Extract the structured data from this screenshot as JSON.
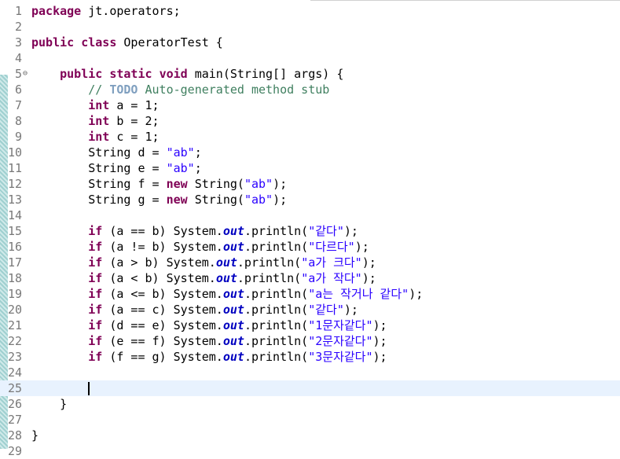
{
  "editor": {
    "lines": [
      {
        "n": "1",
        "toks": [
          [
            "kw",
            "package"
          ],
          [
            "t",
            " jt.operators;"
          ]
        ]
      },
      {
        "n": "2",
        "toks": []
      },
      {
        "n": "3",
        "toks": [
          [
            "kw",
            "public"
          ],
          [
            "t",
            " "
          ],
          [
            "kw",
            "class"
          ],
          [
            "t",
            " OperatorTest {"
          ]
        ]
      },
      {
        "n": "4",
        "toks": []
      },
      {
        "n": "5",
        "fold": true,
        "toks": [
          [
            "t",
            "    "
          ],
          [
            "kw",
            "public"
          ],
          [
            "t",
            " "
          ],
          [
            "kw",
            "static"
          ],
          [
            "t",
            " "
          ],
          [
            "kw",
            "void"
          ],
          [
            "t",
            " main(String[] args) {"
          ]
        ]
      },
      {
        "n": "6",
        "toks": [
          [
            "t",
            "        "
          ],
          [
            "cmt",
            "// "
          ],
          [
            "todo",
            "TODO"
          ],
          [
            "cmt",
            " Auto-generated method stub"
          ]
        ]
      },
      {
        "n": "7",
        "toks": [
          [
            "t",
            "        "
          ],
          [
            "kw",
            "int"
          ],
          [
            "t",
            " a = 1;"
          ]
        ]
      },
      {
        "n": "8",
        "toks": [
          [
            "t",
            "        "
          ],
          [
            "kw",
            "int"
          ],
          [
            "t",
            " b = 2;"
          ]
        ]
      },
      {
        "n": "9",
        "toks": [
          [
            "t",
            "        "
          ],
          [
            "kw",
            "int"
          ],
          [
            "t",
            " c = 1;"
          ]
        ]
      },
      {
        "n": "10",
        "toks": [
          [
            "t",
            "        String d = "
          ],
          [
            "str",
            "\"ab\""
          ],
          [
            "t",
            ";"
          ]
        ]
      },
      {
        "n": "11",
        "toks": [
          [
            "t",
            "        String e = "
          ],
          [
            "str",
            "\"ab\""
          ],
          [
            "t",
            ";"
          ]
        ]
      },
      {
        "n": "12",
        "toks": [
          [
            "t",
            "        String f = "
          ],
          [
            "kw",
            "new"
          ],
          [
            "t",
            " String("
          ],
          [
            "str",
            "\"ab\""
          ],
          [
            "t",
            ");"
          ]
        ]
      },
      {
        "n": "13",
        "toks": [
          [
            "t",
            "        String g = "
          ],
          [
            "kw",
            "new"
          ],
          [
            "t",
            " String("
          ],
          [
            "str",
            "\"ab\""
          ],
          [
            "t",
            ");"
          ]
        ]
      },
      {
        "n": "14",
        "toks": []
      },
      {
        "n": "15",
        "toks": [
          [
            "t",
            "        "
          ],
          [
            "kw",
            "if"
          ],
          [
            "t",
            " (a == b) System."
          ],
          [
            "fld",
            "out"
          ],
          [
            "t",
            ".println("
          ],
          [
            "str",
            "\"같다\""
          ],
          [
            "t",
            ");"
          ]
        ]
      },
      {
        "n": "16",
        "toks": [
          [
            "t",
            "        "
          ],
          [
            "kw",
            "if"
          ],
          [
            "t",
            " (a != b) System."
          ],
          [
            "fld",
            "out"
          ],
          [
            "t",
            ".println("
          ],
          [
            "str",
            "\"다르다\""
          ],
          [
            "t",
            ");"
          ]
        ]
      },
      {
        "n": "17",
        "toks": [
          [
            "t",
            "        "
          ],
          [
            "kw",
            "if"
          ],
          [
            "t",
            " (a > b) System."
          ],
          [
            "fld",
            "out"
          ],
          [
            "t",
            ".println("
          ],
          [
            "str",
            "\"a가 크다\""
          ],
          [
            "t",
            ");"
          ]
        ]
      },
      {
        "n": "18",
        "toks": [
          [
            "t",
            "        "
          ],
          [
            "kw",
            "if"
          ],
          [
            "t",
            " (a < b) System."
          ],
          [
            "fld",
            "out"
          ],
          [
            "t",
            ".println("
          ],
          [
            "str",
            "\"a가 작다\""
          ],
          [
            "t",
            ");"
          ]
        ]
      },
      {
        "n": "19",
        "toks": [
          [
            "t",
            "        "
          ],
          [
            "kw",
            "if"
          ],
          [
            "t",
            " (a <= b) System."
          ],
          [
            "fld",
            "out"
          ],
          [
            "t",
            ".println("
          ],
          [
            "str",
            "\"a는 작거나 같다\""
          ],
          [
            "t",
            ");"
          ]
        ]
      },
      {
        "n": "20",
        "toks": [
          [
            "t",
            "        "
          ],
          [
            "kw",
            "if"
          ],
          [
            "t",
            " (a == c) System."
          ],
          [
            "fld",
            "out"
          ],
          [
            "t",
            ".println("
          ],
          [
            "str",
            "\"같다\""
          ],
          [
            "t",
            ");"
          ]
        ]
      },
      {
        "n": "21",
        "toks": [
          [
            "t",
            "        "
          ],
          [
            "kw",
            "if"
          ],
          [
            "t",
            " (d == e) System."
          ],
          [
            "fld",
            "out"
          ],
          [
            "t",
            ".println("
          ],
          [
            "str",
            "\"1문자같다\""
          ],
          [
            "t",
            ");"
          ]
        ]
      },
      {
        "n": "22",
        "toks": [
          [
            "t",
            "        "
          ],
          [
            "kw",
            "if"
          ],
          [
            "t",
            " (e == f) System."
          ],
          [
            "fld",
            "out"
          ],
          [
            "t",
            ".println("
          ],
          [
            "str",
            "\"2문자같다\""
          ],
          [
            "t",
            ");"
          ]
        ]
      },
      {
        "n": "23",
        "toks": [
          [
            "t",
            "        "
          ],
          [
            "kw",
            "if"
          ],
          [
            "t",
            " (f == g) System."
          ],
          [
            "fld",
            "out"
          ],
          [
            "t",
            ".println("
          ],
          [
            "str",
            "\"3문자같다\""
          ],
          [
            "t",
            ");"
          ]
        ]
      },
      {
        "n": "24",
        "toks": []
      },
      {
        "n": "25",
        "current": true,
        "toks": []
      },
      {
        "n": "26",
        "toks": [
          [
            "t",
            "    }"
          ]
        ]
      },
      {
        "n": "27",
        "toks": []
      },
      {
        "n": "28",
        "toks": [
          [
            "t",
            "}"
          ]
        ]
      },
      {
        "n": "29",
        "toks": []
      }
    ],
    "fold_icon": "collapse-minus-icon",
    "colors": {
      "keyword": "#7f0055",
      "string": "#2a00ff",
      "comment": "#3f7f5f",
      "field": "#0000c0",
      "current_line": "#e8f2fe"
    }
  }
}
